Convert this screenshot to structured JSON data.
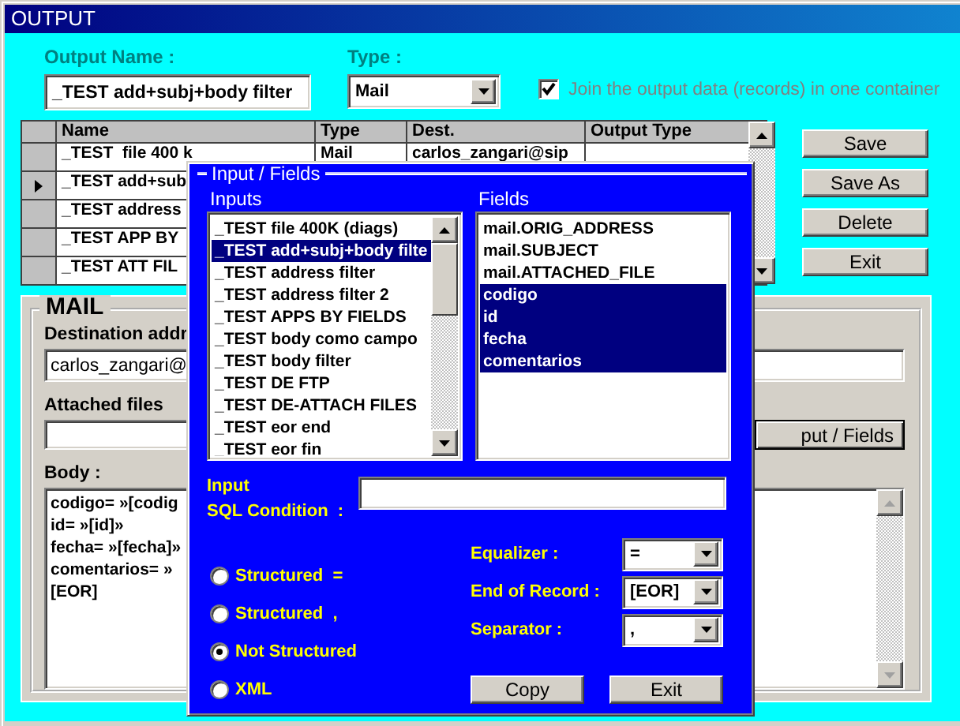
{
  "window": {
    "title": "OUTPUT"
  },
  "output_name": {
    "label": "Output Name :",
    "value": "_TEST add+subj+body filter"
  },
  "type": {
    "label": "Type :",
    "value": "Mail"
  },
  "join_checkbox": {
    "label": "Join the output data (records) in one container",
    "checked": true
  },
  "grid": {
    "columns": [
      "Name",
      "Type",
      "Dest.",
      "Output Type"
    ],
    "rows": [
      {
        "cells": [
          "_TEST  file 400 k",
          "Mail",
          "carlos_zangari@sip"
        ],
        "current": false
      },
      {
        "cells": [
          "_TEST add+sub"
        ],
        "current": true
      },
      {
        "cells": [
          "_TEST address"
        ],
        "current": false
      },
      {
        "cells": [
          "_TEST APP BY"
        ],
        "current": false
      },
      {
        "cells": [
          "_TEST ATT FIL"
        ],
        "current": false
      }
    ]
  },
  "buttons": [
    "Save",
    "Save As",
    "Delete",
    "Exit"
  ],
  "mail": {
    "title": "MAIL",
    "destination": {
      "label": "Destination addr",
      "value": "carlos_zangari@"
    },
    "attached": {
      "label": "Attached files",
      "button": "put / Fields"
    },
    "body": {
      "label": "Body :",
      "lines": [
        "codigo= »[codig",
        "id= »[id]»",
        "fecha= »[fecha]»",
        "comentarios= »",
        "[EOR]"
      ]
    }
  },
  "dialog": {
    "title": "Input / Fields",
    "inputs": {
      "label": "Inputs",
      "items": [
        {
          "label": "_TEST  file 400K (diags)",
          "selected": false
        },
        {
          "label": "_TEST add+subj+body filte",
          "selected": true
        },
        {
          "label": "_TEST address filter",
          "selected": false
        },
        {
          "label": "_TEST address filter 2",
          "selected": false
        },
        {
          "label": "_TEST APPS BY FIELDS",
          "selected": false
        },
        {
          "label": "_TEST body como campo",
          "selected": false
        },
        {
          "label": "_TEST body filter",
          "selected": false
        },
        {
          "label": "_TEST DE FTP",
          "selected": false
        },
        {
          "label": "_TEST DE-ATTACH FILES",
          "selected": false
        },
        {
          "label": "_TEST eor end",
          "selected": false
        },
        {
          "label": "_TEST eor fin",
          "selected": false
        }
      ]
    },
    "fields": {
      "label": "Fields",
      "items": [
        {
          "label": "mail.ORIG_ADDRESS",
          "selected": false
        },
        {
          "label": "mail.SUBJECT",
          "selected": false
        },
        {
          "label": "mail.ATTACHED_FILE",
          "selected": false
        },
        {
          "label": "codigo",
          "selected": true
        },
        {
          "label": "id",
          "selected": true
        },
        {
          "label": "fecha",
          "selected": true
        },
        {
          "label": "comentarios",
          "selected": true
        }
      ]
    },
    "sql": {
      "label_1": "Input",
      "label_2": "SQL Condition  :"
    },
    "formats": [
      {
        "label": "Structured  =",
        "selected": false
      },
      {
        "label": "Structured  ,",
        "selected": false
      },
      {
        "label": "Not Structured",
        "selected": true
      },
      {
        "label": "XML",
        "selected": false
      }
    ],
    "options": [
      {
        "label": "Equalizer :",
        "value": "="
      },
      {
        "label": "End of Record :",
        "value": "[EOR]"
      },
      {
        "label": "Separator :",
        "value": ","
      }
    ],
    "buttons": [
      "Copy",
      "Exit"
    ]
  }
}
